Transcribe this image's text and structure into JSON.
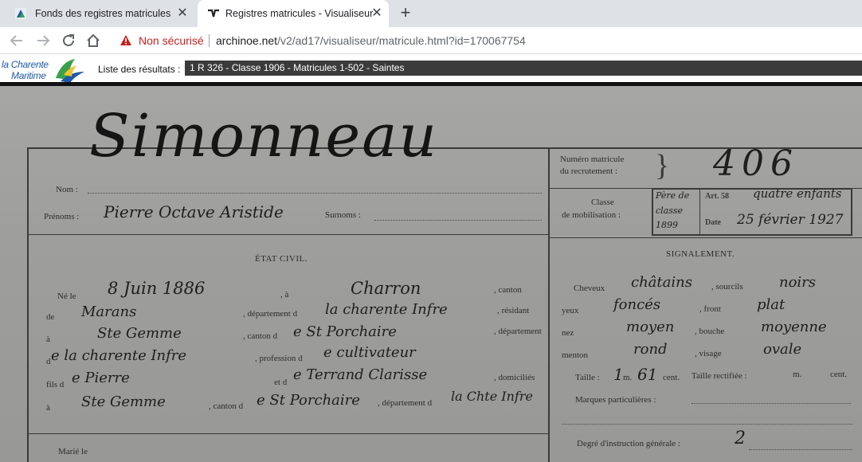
{
  "browser": {
    "tabs": [
      {
        "title": "Fonds des registres matricules",
        "active": false
      },
      {
        "title": "Registres matricules - Visualiseur",
        "active": true
      }
    ],
    "new_tab_symbol": "+",
    "close_symbol": "✕",
    "security_label": "Non sécurisé",
    "url_host": "archinoe.net",
    "url_path": "/v2/ad17/visualiseur/matricule.html?id=170067754"
  },
  "site": {
    "logo_line1": "la Charente",
    "logo_line2": "Maritime",
    "results_label": "Liste des résultats :",
    "results_value": "1 R 326 - Classe 1906 - Matricules 1-502 - Saintes"
  },
  "document": {
    "name_handwritten": "Simonneau",
    "nom_label": "Nom :",
    "prenoms_label": "Prénoms :",
    "prenoms_value": "Pierre Octave Aristide",
    "surnoms_label": "Surnoms :",
    "numero_label_1": "Numéro matricule",
    "numero_label_2": "du recrutement :",
    "numero_value": "406",
    "classe_label_1": "Classe",
    "classe_label_2": "de mobilisation :",
    "stamp_line1": "Père de",
    "stamp_art": "Art. 58",
    "stamp_children": "quatre enfants",
    "stamp_line2": "classe",
    "stamp_date_label": "Date",
    "stamp_date": "25 février 1927",
    "stamp_line3": "1899",
    "etat_civil_title": "ÉTAT CIVIL.",
    "ne_le_label": "Né le",
    "ne_le_value": "8 Juin 1886",
    "a_label": ", à",
    "a_value": "Charron",
    "canton_label": ", canton",
    "de_label": "de",
    "canton_value": "Marans",
    "departement_label": ", département d",
    "departement_value": "la charente Infre",
    "residant_label": ", résidant",
    "a2_label": "à",
    "residant_value": "Ste Gemme",
    "canton_de_label": ", canton d",
    "canton_de_value": "e St Porchaire",
    "departement2_label": ", département",
    "d_label": "d",
    "departement2_value": "e la charente Infre",
    "profession_label": ", profession d",
    "profession_value": "e cultivateur",
    "fils_label": "fils d",
    "father_value": "e Pierre",
    "et_label": "et d",
    "mother_value": "e Terrand Clarisse",
    "domicilies_label": ", domiciliés",
    "a3_label": "à",
    "domicile_value": "Ste Gemme",
    "canton3_label": ", canton d",
    "canton3_value": "e St Porchaire",
    "departement3_label": ", département d",
    "departement3_value": "la Chte Infre",
    "marie_label": "Marié le",
    "signalement_title": "SIGNALEMENT.",
    "cheveux_label": "Cheveux",
    "cheveux_value": "châtains",
    "sourcils_label": ", sourcils",
    "sourcils_value": "noirs",
    "yeux_label": "yeux",
    "yeux_value": "foncés",
    "front_label": ", front",
    "front_value": "plat",
    "nez_label": "nez",
    "nez_value": "moyen",
    "bouche_label": ", bouche",
    "bouche_value": "moyenne",
    "menton_label": "menton",
    "menton_value": "rond",
    "visage_label": ", visage",
    "visage_value": "ovale",
    "taille_label": "Taille :",
    "taille_m": "1",
    "taille_m_unit": "m.",
    "taille_cm": "61",
    "taille_cm_unit": "cent.",
    "taille_rectifiee_label": "Taille rectifiée :",
    "taille_rectifiee_m": "m.",
    "taille_rectifiee_cm": "cent.",
    "marques_label": "Marques particulières :",
    "degre_label": "Degré d'instruction générale :",
    "degre_value": "2"
  },
  "colors": {
    "tabstrip": "#dee1e6",
    "warning_red": "#c5221f",
    "brand_blue": "#1f5aa8",
    "brand_green": "#3aa14a",
    "results_bar": "#3b3b3b"
  },
  "icons": [
    "favicon-archinoe-icon",
    "favicon-visualiseur-icon",
    "close-icon",
    "new-tab-icon",
    "back-icon",
    "forward-icon",
    "reload-icon",
    "home-icon",
    "warning-icon",
    "logo-bird-icon"
  ]
}
